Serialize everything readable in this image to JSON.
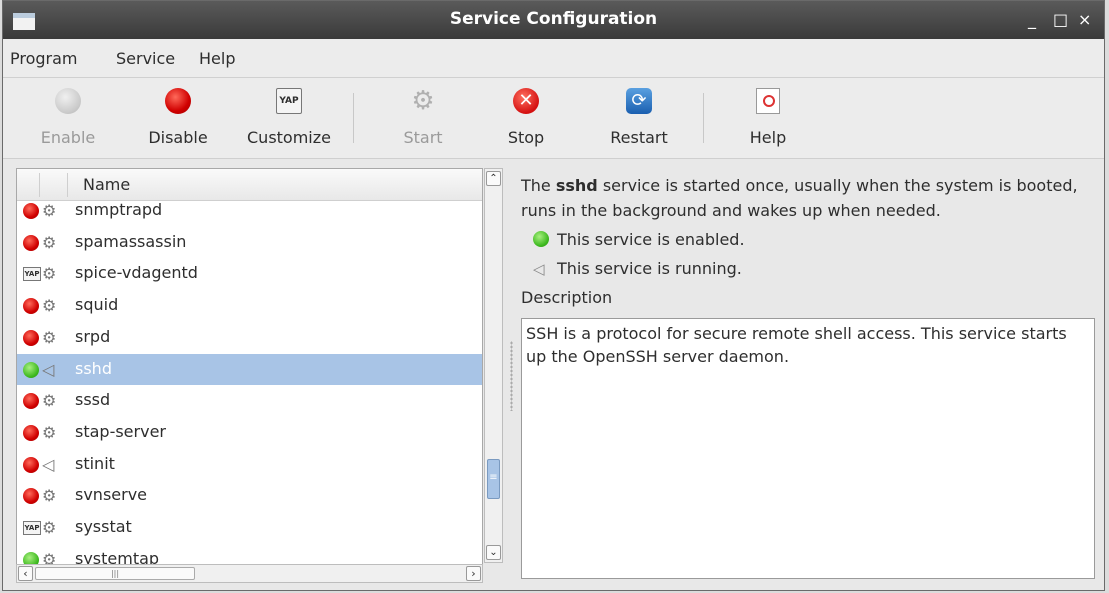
{
  "window": {
    "title": "Service Configuration",
    "controls": [
      "_",
      "□",
      "×"
    ]
  },
  "menu": [
    "Program",
    "Service",
    "Help"
  ],
  "toolbar": {
    "enable": "Enable",
    "disable": "Disable",
    "customize": "Customize",
    "start": "Start",
    "stop": "Stop",
    "restart": "Restart",
    "help": "Help",
    "customize_icon_text": "YAP",
    "disabled_buttons": [
      "Enable",
      "Start"
    ]
  },
  "list": {
    "header": "Name",
    "selected": "sshd",
    "rows": [
      {
        "name": "snmptrapd",
        "status": "disabled",
        "runstate": "stopped"
      },
      {
        "name": "spamassassin",
        "status": "disabled",
        "runstate": "stopped"
      },
      {
        "name": "spice-vdagentd",
        "status": "customized",
        "runstate": "stopped"
      },
      {
        "name": "squid",
        "status": "disabled",
        "runstate": "stopped"
      },
      {
        "name": "srpd",
        "status": "disabled",
        "runstate": "stopped"
      },
      {
        "name": "sshd",
        "status": "enabled",
        "runstate": "running"
      },
      {
        "name": "sssd",
        "status": "disabled",
        "runstate": "stopped"
      },
      {
        "name": "stap-server",
        "status": "disabled",
        "runstate": "stopped"
      },
      {
        "name": "stinit",
        "status": "disabled",
        "runstate": "running"
      },
      {
        "name": "svnserve",
        "status": "disabled",
        "runstate": "stopped"
      },
      {
        "name": "sysstat",
        "status": "customized",
        "runstate": "stopped"
      },
      {
        "name": "systemtap",
        "status": "enabled",
        "runstate": "stopped"
      }
    ]
  },
  "detail": {
    "summary_pre": "The ",
    "summary_service": "sshd",
    "summary_post": " service is started once, usually when the system is booted, runs in the background and wakes up when needed.",
    "enabled_text": "This service is enabled.",
    "running_text": "This service is running.",
    "description_label": "Description",
    "description": "SSH is a protocol for secure remote shell access. This service starts up the OpenSSH server daemon."
  },
  "colors": {
    "selection": "#a8c4e6",
    "titlebar": "#3a3a3a",
    "enabled": "#3cb81e",
    "disabled": "#d00000"
  }
}
